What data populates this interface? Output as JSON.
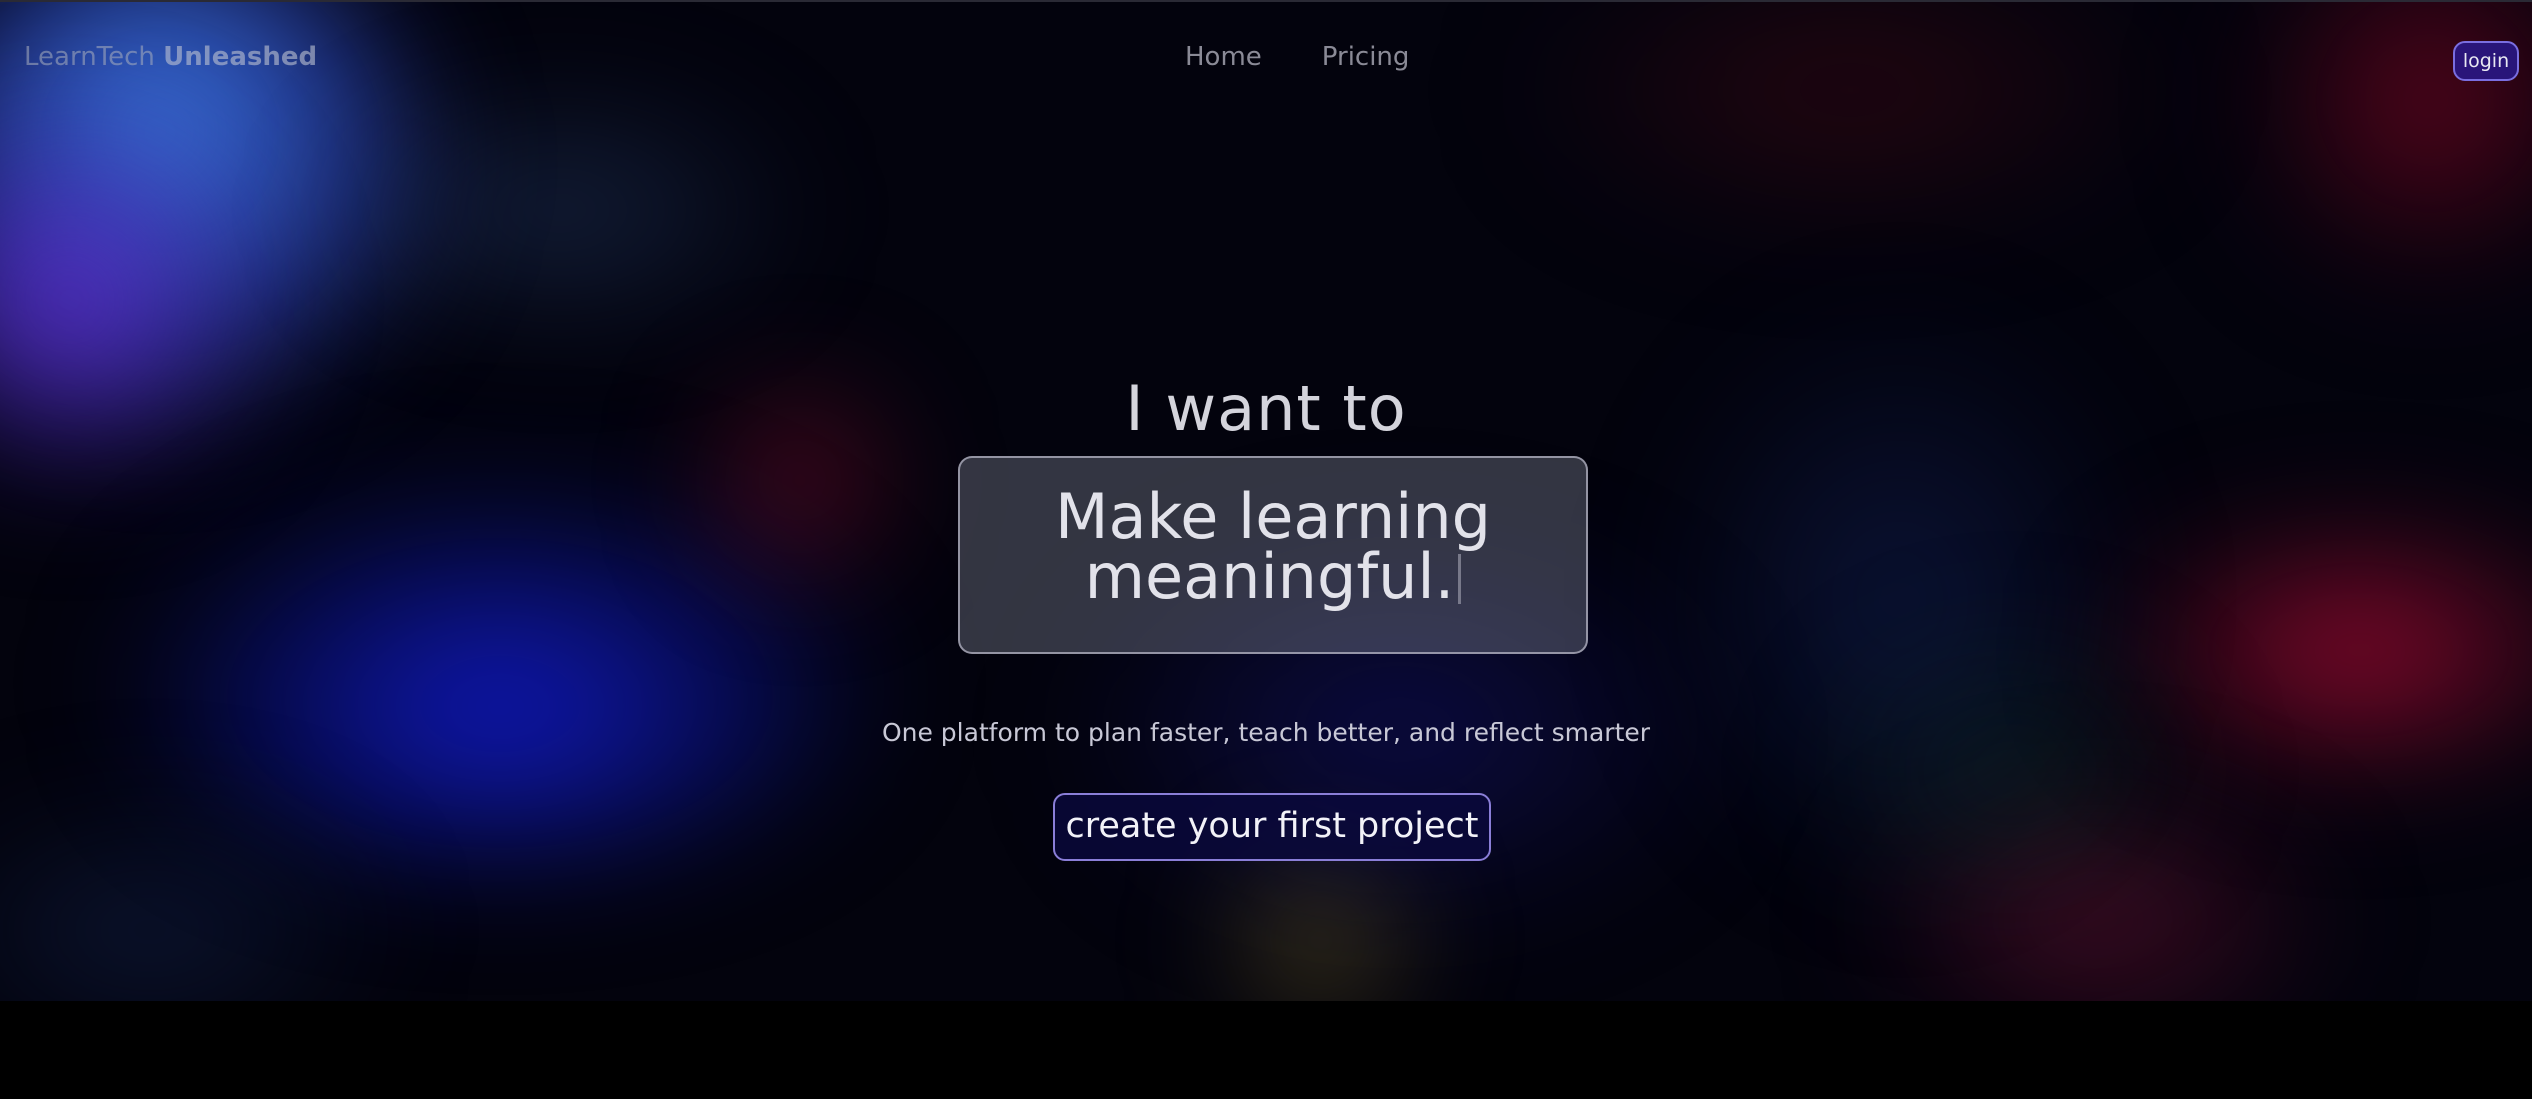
{
  "nav": {
    "brand_light": "LearnTech ",
    "brand_bold": "Unleashed",
    "links": [
      {
        "label": "Home"
      },
      {
        "label": "Pricing"
      }
    ],
    "login_label": "login"
  },
  "hero": {
    "headline": "I want to",
    "rotating_line1": "Make learning",
    "rotating_line2": "meaningful.",
    "subtitle": "One platform to plan faster, teach better, and reflect smarter",
    "cta_label": "create your first project"
  },
  "colors": {
    "accent_border": "#7a6ee0",
    "login_bg": "#28198c",
    "page_bg": "#000000"
  }
}
